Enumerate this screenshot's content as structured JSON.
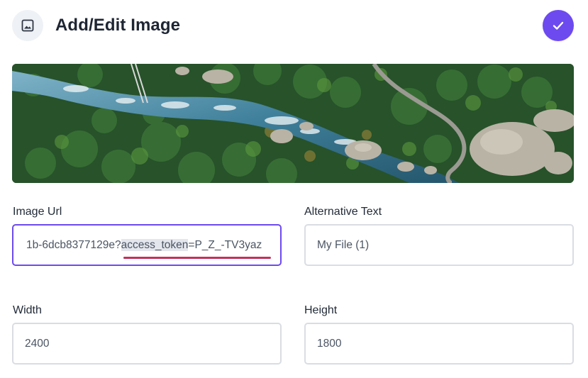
{
  "header": {
    "title": "Add/Edit Image",
    "image_icon": "image-icon",
    "confirm_icon": "checkmark-icon",
    "accent_color": "#6d4aef"
  },
  "preview": {
    "description_icon": "image-preview"
  },
  "form": {
    "image_url": {
      "label": "Image Url",
      "value_before": "1b-6dcb8377129e?",
      "value_highlight": "access_token",
      "value_after": "=P_Z_-TV3yaz"
    },
    "alt_text": {
      "label": "Alternative Text",
      "value": "My File (1)"
    },
    "width": {
      "label": "Width",
      "value": "2400"
    },
    "height": {
      "label": "Height",
      "value": "1800"
    }
  }
}
